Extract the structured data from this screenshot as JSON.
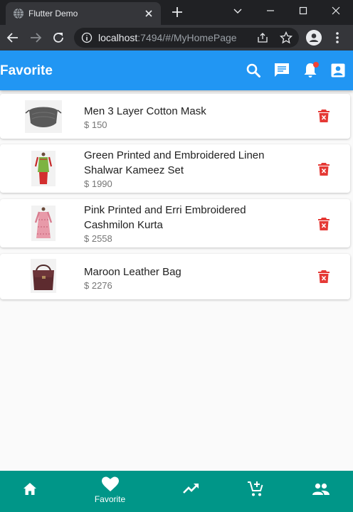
{
  "browser": {
    "tab_title": "Flutter Demo",
    "url_host": "localhost",
    "url_rest": ":7494/#/MyHomePage",
    "icons": [
      "globe-icon",
      "close-icon",
      "plus-icon",
      "chevron-down-icon",
      "minimize-icon",
      "maximize-icon",
      "close-window-icon",
      "back-arrow-icon",
      "forward-arrow-icon",
      "reload-icon",
      "info-icon",
      "share-icon",
      "star-icon",
      "profile-icon",
      "more-vert-icon"
    ]
  },
  "appbar": {
    "title": "Favorite",
    "background": "#2196f3",
    "icons": [
      "search-icon",
      "message-icon",
      "notifications-icon",
      "account-box-icon"
    ],
    "notification_dot_color": "#f44336"
  },
  "favorites": [
    {
      "name": "Men 3 Layer Cotton Mask",
      "price": "$ 150"
    },
    {
      "name": "Green Printed and Embroidered Linen Shalwar Kameez Set",
      "price": "$ 1990"
    },
    {
      "name": "Pink Printed and Erri Embroidered Cashmilon Kurta",
      "price": "$ 2558"
    },
    {
      "name": "Maroon Leather Bag",
      "price": "$ 2276"
    }
  ],
  "delete_icon_color": "#e53935",
  "bottom_nav": {
    "background": "#009688",
    "items": [
      {
        "icon": "home-icon",
        "label": ""
      },
      {
        "icon": "favorite-icon",
        "label": "Favorite",
        "selected": true
      },
      {
        "icon": "trending-up-icon",
        "label": ""
      },
      {
        "icon": "add-shopping-cart-icon",
        "label": ""
      },
      {
        "icon": "people-icon",
        "label": ""
      }
    ]
  }
}
